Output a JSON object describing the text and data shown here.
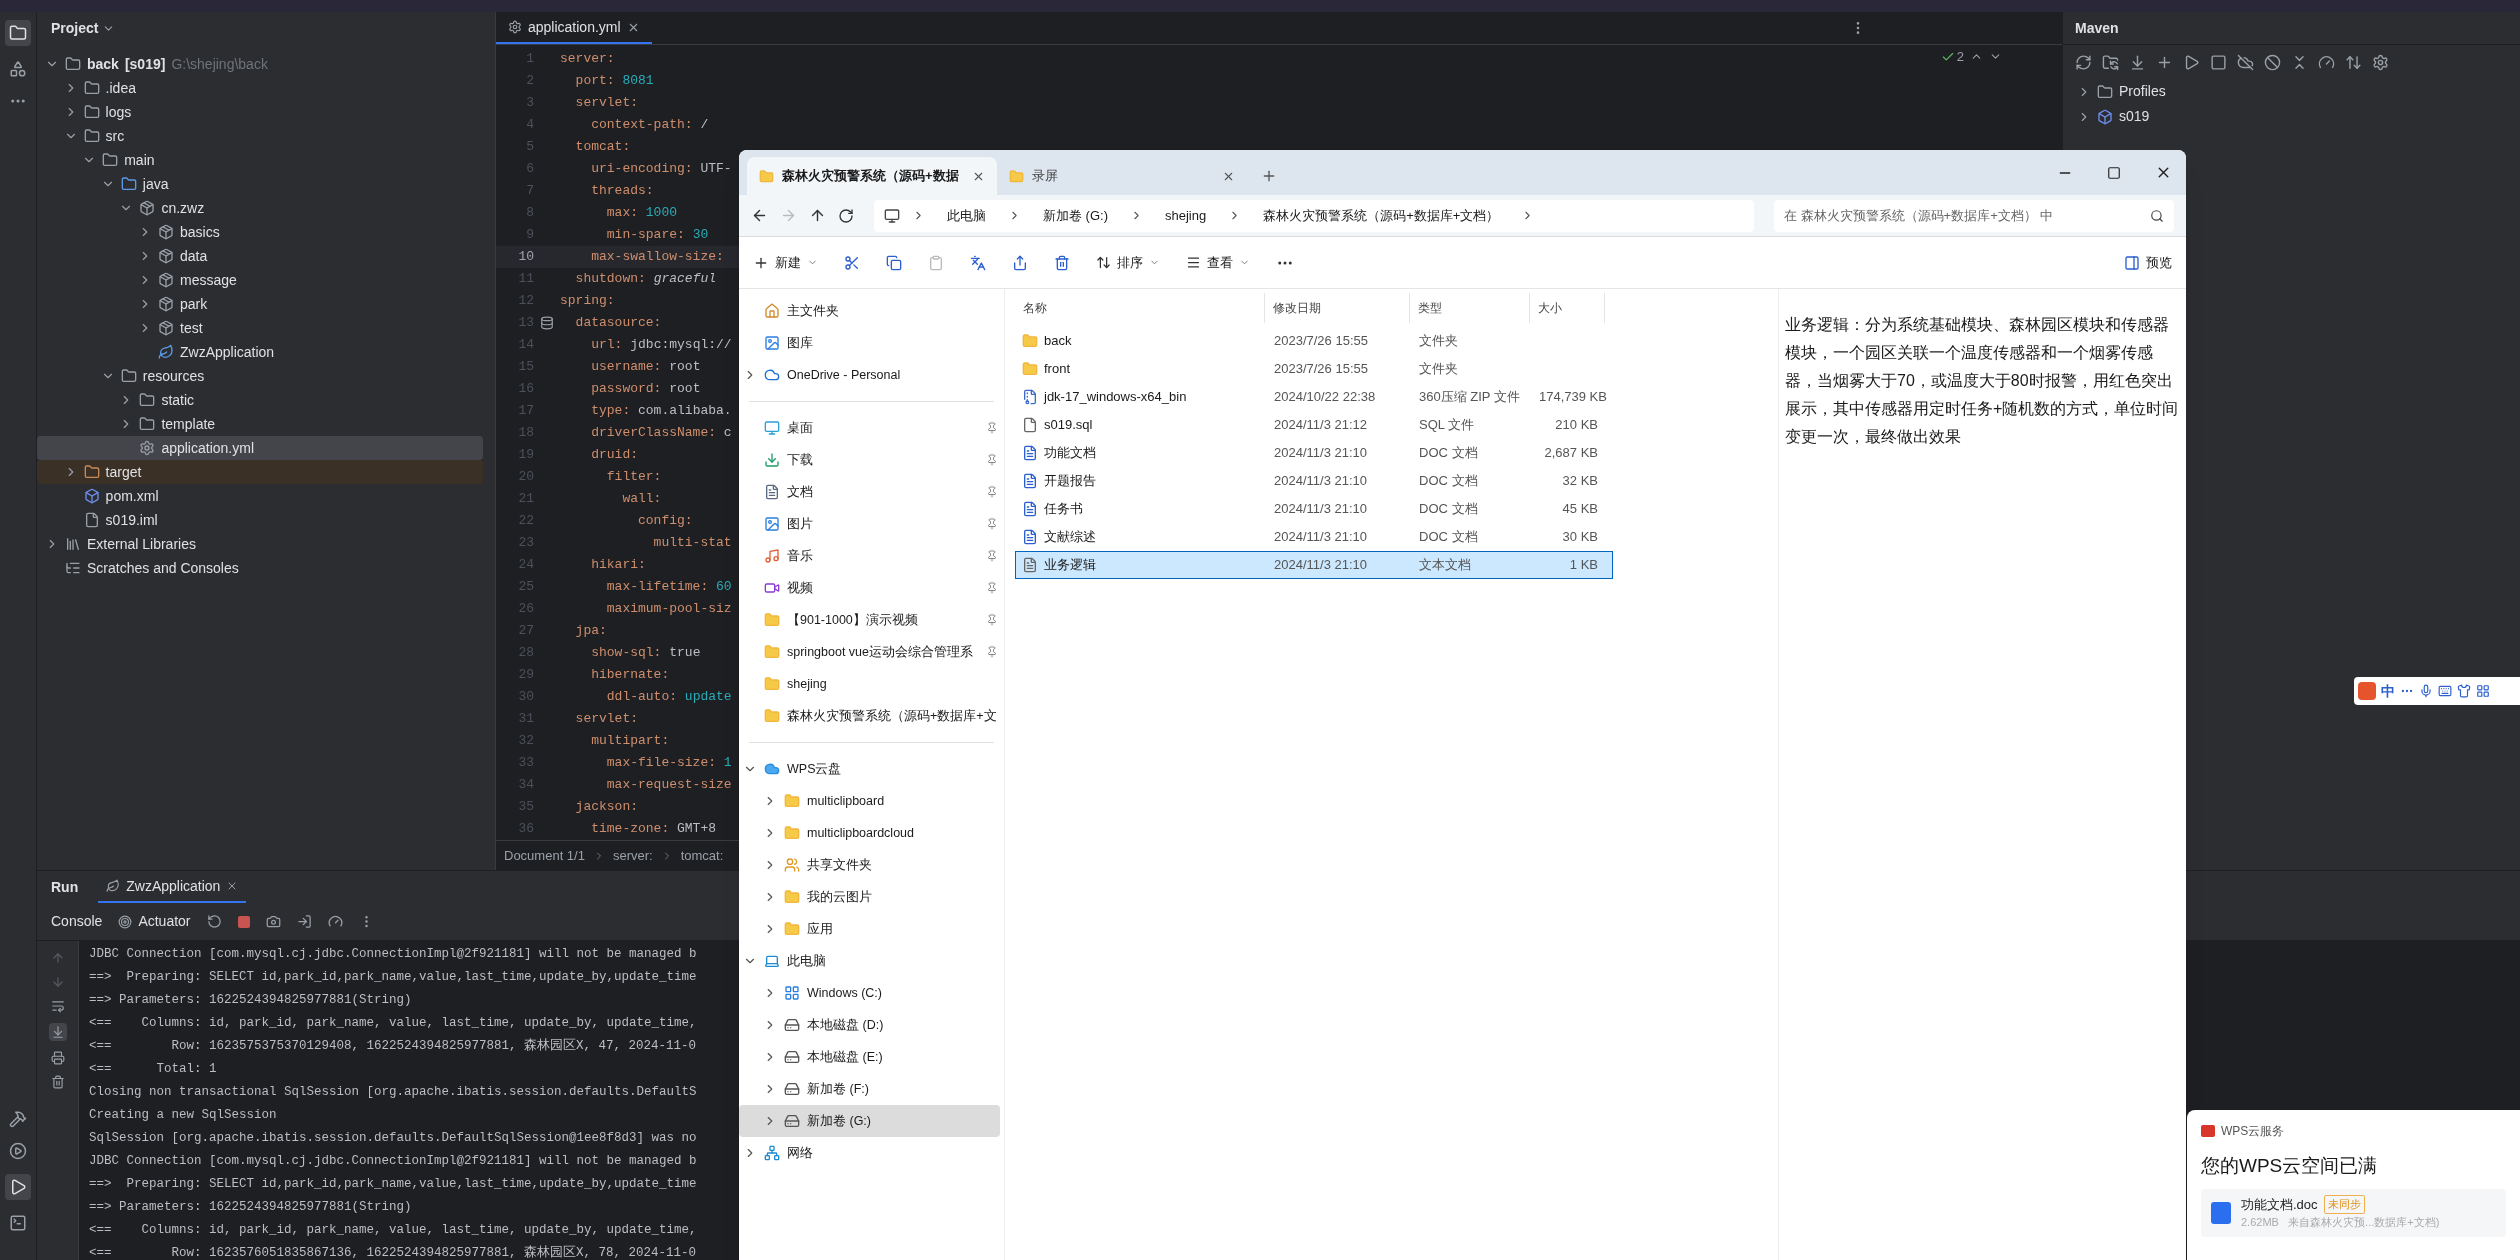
{
  "ide": {
    "project_panel": {
      "title": "Project",
      "tree": [
        {
          "label": "back",
          "module": "[s019]",
          "path": "G:\\shejing\\back",
          "kind": "module",
          "expanded": true,
          "selected": false,
          "children": [
            {
              "label": ".idea",
              "kind": "folder",
              "expanded": false,
              "selected": false
            },
            {
              "label": "logs",
              "kind": "folder",
              "expanded": false,
              "selected": false
            },
            {
              "label": "src",
              "kind": "folder",
              "expanded": true,
              "selected": false,
              "children": [
                {
                  "label": "main",
                  "kind": "folder",
                  "expanded": true,
                  "selected": false,
                  "children": [
                    {
                      "label": "java",
                      "kind": "source",
                      "expanded": true,
                      "selected": false,
                      "children": [
                        {
                          "label": "cn.zwz",
                          "kind": "package",
                          "expanded": true,
                          "selected": false,
                          "children": [
                            {
                              "label": "basics",
                              "kind": "package",
                              "expanded": false,
                              "selected": false
                            },
                            {
                              "label": "data",
                              "kind": "package",
                              "expanded": false,
                              "selected": false
                            },
                            {
                              "label": "message",
                              "kind": "package",
                              "expanded": false,
                              "selected": false
                            },
                            {
                              "label": "park",
                              "kind": "package",
                              "expanded": false,
                              "selected": false
                            },
                            {
                              "label": "test",
                              "kind": "package",
                              "expanded": false,
                              "selected": false
                            },
                            {
                              "label": "ZwzApplication",
                              "kind": "spring",
                              "selected": false
                            }
                          ]
                        }
                      ]
                    },
                    {
                      "label": "resources",
                      "kind": "resources",
                      "expanded": true,
                      "selected": false,
                      "children": [
                        {
                          "label": "static",
                          "kind": "folder",
                          "expanded": false,
                          "selected": false
                        },
                        {
                          "label": "template",
                          "kind": "folder",
                          "expanded": false,
                          "selected": false
                        },
                        {
                          "label": "application.yml",
                          "kind": "yml",
                          "selected": true
                        }
                      ]
                    }
                  ]
                }
              ]
            },
            {
              "label": "target",
              "kind": "excluded",
              "expanded": false,
              "selected": false
            },
            {
              "label": "pom.xml",
              "kind": "maven",
              "selected": false
            },
            {
              "label": "s019.iml",
              "kind": "iml",
              "selected": false
            }
          ]
        },
        {
          "label": "External Libraries",
          "kind": "libraries",
          "expanded": false,
          "selected": false
        },
        {
          "label": "Scratches and Consoles",
          "kind": "scratches",
          "selected": false
        }
      ]
    },
    "editor": {
      "tab": "application.yml",
      "problems": "2",
      "lines": [
        {
          "number": "1",
          "key": "server:",
          "current": false
        },
        {
          "number": "2",
          "key": "  port:",
          "value": " 8081",
          "kind": "number",
          "current": false
        },
        {
          "number": "3",
          "key": "  servlet:",
          "current": false
        },
        {
          "number": "4",
          "key": "    context-path:",
          "value": " /",
          "kind": "plain",
          "current": false
        },
        {
          "number": "5",
          "key": "  tomcat:",
          "current": false
        },
        {
          "number": "6",
          "key": "    uri-encoding:",
          "value": " UTF-",
          "kind": "plain",
          "current": false
        },
        {
          "number": "7",
          "key": "    threads:",
          "current": false
        },
        {
          "number": "8",
          "key": "      max:",
          "value": " 1000",
          "kind": "number",
          "current": false
        },
        {
          "number": "9",
          "key": "      min-spare:",
          "value": " 30",
          "kind": "number",
          "current": false
        },
        {
          "number": "10",
          "key": "    max-swallow-size:",
          "current": true
        },
        {
          "number": "11",
          "key": "  shutdown:",
          "value": " graceful",
          "kind": "italic",
          "current": false
        },
        {
          "number": "12",
          "key": "spring:",
          "current": false
        },
        {
          "number": "13",
          "key": "  datasource:",
          "current": false,
          "marker": true
        },
        {
          "number": "14",
          "key": "    url:",
          "value": " jdbc:mysql://",
          "kind": "plain",
          "current": false
        },
        {
          "number": "15",
          "key": "    username:",
          "value": " root",
          "kind": "plain",
          "current": false
        },
        {
          "number": "16",
          "key": "    password:",
          "value": " root",
          "kind": "plain",
          "current": false
        },
        {
          "number": "17",
          "key": "    type:",
          "value": " com.alibaba.",
          "kind": "plain",
          "current": false
        },
        {
          "number": "18",
          "key": "    driverClassName:",
          "value": " c",
          "kind": "plain",
          "current": false
        },
        {
          "number": "19",
          "key": "    druid:",
          "current": false
        },
        {
          "number": "20",
          "key": "      filter:",
          "current": false
        },
        {
          "number": "21",
          "key": "        wall:",
          "current": false
        },
        {
          "number": "22",
          "key": "          config:",
          "current": false
        },
        {
          "number": "23",
          "key": "            multi-stat",
          "current": false
        },
        {
          "number": "24",
          "key": "    hikari:",
          "current": false
        },
        {
          "number": "25",
          "key": "      max-lifetime:",
          "value": " 60",
          "kind": "number",
          "current": false
        },
        {
          "number": "26",
          "key": "      maximum-pool-siz",
          "current": false
        },
        {
          "number": "27",
          "key": "  jpa:",
          "current": false
        },
        {
          "number": "28",
          "key": "    show-sql:",
          "value": " true",
          "kind": "plain",
          "current": false
        },
        {
          "number": "29",
          "key": "    hibernate:",
          "current": false
        },
        {
          "number": "30",
          "key": "      ddl-auto:",
          "value": " update",
          "kind": "number",
          "current": false
        },
        {
          "number": "31",
          "key": "  servlet:",
          "current": false
        },
        {
          "number": "32",
          "key": "    multipart:",
          "current": false
        },
        {
          "number": "33",
          "key": "      max-file-size:",
          "value": " 1",
          "kind": "number",
          "current": false
        },
        {
          "number": "34",
          "key": "      max-request-size",
          "current": false
        },
        {
          "number": "35",
          "key": "  jackson:",
          "current": false
        },
        {
          "number": "36",
          "key": "    time-zone:",
          "value": " GMT+8",
          "kind": "plain",
          "current": false
        }
      ],
      "breadcrumbs": [
        "Document 1/1",
        "server:",
        "tomcat:"
      ]
    },
    "maven": {
      "title": "Maven",
      "tree": [
        {
          "label": "Profiles",
          "kind": "profiles",
          "expanded": false
        },
        {
          "label": "s019",
          "kind": "maven",
          "expanded": false
        }
      ]
    },
    "run": {
      "title": "Run",
      "tab": "ZwzApplication",
      "console_tabs": [
        "Console",
        "Actuator"
      ],
      "lines": [
        "JDBC Connection [com.mysql.cj.jdbc.ConnectionImpl@2f921181] will not be managed b",
        "==>  Preparing: SELECT id,park_id,park_name,value,last_time,update_by,update_time",
        "==> Parameters: 1622524394825977881(String)",
        "<==    Columns: id, park_id, park_name, value, last_time, update_by, update_time,",
        "<==        Row: 1623575375370129408, 1622524394825977881, 森林园区X, 47, 2024-11-0",
        "<==      Total: 1",
        "Closing non transactional SqlSession [org.apache.ibatis.session.defaults.DefaultS",
        "Creating a new SqlSession",
        "SqlSession [org.apache.ibatis.session.defaults.DefaultSqlSession@1ee8f8d3] was no",
        "JDBC Connection [com.mysql.cj.jdbc.ConnectionImpl@2f921181] will not be managed b",
        "==>  Preparing: SELECT id,park_id,park_name,value,last_time,update_by,update_time",
        "==> Parameters: 1622524394825977881(String)",
        "<==    Columns: id, park_id, park_name, value, last_time, update_by, update_time,",
        "<==        Row: 1623576051835867136, 1622524394825977881, 森林园区X, 78, 2024-11-0"
      ]
    }
  },
  "explorer": {
    "tabs": [
      {
        "label": "森林火灾预警系统（源码+数据",
        "selected": true
      },
      {
        "label": "录屏",
        "selected": false
      }
    ],
    "address": [
      "此电脑",
      "新加卷 (G:)",
      "shejing",
      "森林火灾预警系统（源码+数据库+文档）"
    ],
    "search": {
      "placeholder": "在 森林火灾预警系统（源码+数据库+文档） 中"
    },
    "toolbar": {
      "new": "新建",
      "sort": "排序",
      "view": "查看",
      "preview": "预览"
    },
    "sidebar": [
      {
        "label": "主文件夹",
        "kind": "home",
        "selected": false
      },
      {
        "label": "图库",
        "kind": "gallery",
        "selected": false
      },
      {
        "label": "OneDrive - Personal",
        "kind": "onedrive",
        "expanded": false,
        "selected": false
      },
      {
        "label": "桌面",
        "kind": "desktop",
        "pinned": true,
        "selected": false
      },
      {
        "label": "下载",
        "kind": "download",
        "pinned": true,
        "selected": false
      },
      {
        "label": "文档",
        "kind": "documents",
        "pinned": true,
        "selected": false
      },
      {
        "label": "图片",
        "kind": "pictures",
        "pinned": true,
        "selected": false
      },
      {
        "label": "音乐",
        "kind": "music",
        "pinned": true,
        "selected": false
      },
      {
        "label": "视频",
        "kind": "videos",
        "pinned": true,
        "selected": false
      },
      {
        "label": "【901-1000】演示视频",
        "kind": "folder",
        "pinned": true,
        "selected": false
      },
      {
        "label": "springboot vue运动会综合管理系",
        "kind": "folder",
        "pinned": true,
        "selected": false
      },
      {
        "label": "shejing",
        "kind": "folder",
        "pinned": false,
        "selected": false
      },
      {
        "label": "森林火灾预警系统（源码+数据库+文",
        "kind": "folder",
        "pinned": false,
        "selected": false
      },
      {
        "label": "WPS云盘",
        "kind": "wps",
        "expanded": true,
        "selected": false,
        "children": [
          {
            "label": "multiclipboard",
            "kind": "folder",
            "expanded": false,
            "selected": false
          },
          {
            "label": "multiclipboardcloud",
            "kind": "folder",
            "expanded": false,
            "selected": false
          },
          {
            "label": "共享文件夹",
            "kind": "shared",
            "expanded": false,
            "selected": false
          },
          {
            "label": "我的云图片",
            "kind": "folder",
            "expanded": false,
            "selected": false
          },
          {
            "label": "应用",
            "kind": "folder",
            "expanded": false,
            "selected": false
          }
        ]
      },
      {
        "label": "此电脑",
        "kind": "pc",
        "expanded": true,
        "selected": false,
        "children": [
          {
            "label": "Windows (C:)",
            "kind": "windows",
            "expanded": false,
            "selected": false
          },
          {
            "label": "本地磁盘 (D:)",
            "kind": "drive",
            "expanded": false,
            "selected": false
          },
          {
            "label": "本地磁盘 (E:)",
            "kind": "drive",
            "expanded": false,
            "selected": false
          },
          {
            "label": "新加卷 (F:)",
            "kind": "drive",
            "expanded": false,
            "selected": false
          },
          {
            "label": "新加卷 (G:)",
            "kind": "drive",
            "expanded": false,
            "selected": true
          }
        ]
      },
      {
        "label": "网络",
        "kind": "network",
        "expanded": false,
        "selected": false
      }
    ],
    "columns": [
      "名称",
      "修改日期",
      "类型",
      "大小"
    ],
    "files": [
      {
        "name": "back",
        "modified": "2023/7/26 15:55",
        "type": "文件夹",
        "kind": "folder",
        "selected": false
      },
      {
        "name": "front",
        "modified": "2023/7/26 15:55",
        "type": "文件夹",
        "kind": "folder",
        "selected": false
      },
      {
        "name": "jdk-17_windows-x64_bin",
        "modified": "2024/10/22 22:38",
        "type": "360压缩 ZIP 文件",
        "size": "174,739 KB",
        "kind": "zip",
        "selected": false
      },
      {
        "name": "s019.sql",
        "modified": "2024/11/3 21:12",
        "type": "SQL 文件",
        "size": "210 KB",
        "kind": "sql",
        "selected": false
      },
      {
        "name": "功能文档",
        "modified": "2024/11/3 21:10",
        "type": "DOC 文档",
        "size": "2,687 KB",
        "kind": "doc",
        "selected": false
      },
      {
        "name": "开题报告",
        "modified": "2024/11/3 21:10",
        "type": "DOC 文档",
        "size": "32 KB",
        "kind": "doc",
        "selected": false
      },
      {
        "name": "任务书",
        "modified": "2024/11/3 21:10",
        "type": "DOC 文档",
        "size": "45 KB",
        "kind": "doc",
        "selected": false
      },
      {
        "name": "文献综述",
        "modified": "2024/11/3 21:10",
        "type": "DOC 文档",
        "size": "30 KB",
        "kind": "doc",
        "selected": false
      },
      {
        "name": "业务逻辑",
        "modified": "2024/11/3 21:10",
        "type": "文本文档",
        "size": "1 KB",
        "kind": "txt",
        "selected": true
      }
    ],
    "preview_text": "业务逻辑：分为系统基础模块、森林园区模块和传感器模块，一个园区关联一个温度传感器和一个烟雾传感器，当烟雾大于70，或温度大于80时报警，用红色突出展示，其中传感器用定时任务+随机数的方式，单位时间变更一次，最终做出效果"
  },
  "ime": {
    "mode": "中"
  },
  "wps_popup": {
    "app": "WPS云服务",
    "heading": "您的WPS云空间已满",
    "file": "功能文档.doc",
    "badge": "未同步",
    "meta": "2.62MB   来自森林火灾预...数据库+文档)"
  }
}
